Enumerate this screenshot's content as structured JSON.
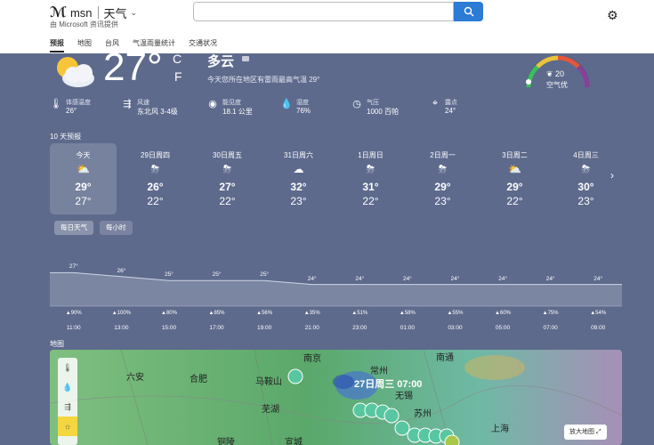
{
  "header": {
    "logo": "msn",
    "section": "天气",
    "provider": "由 Microsoft 资讯提供",
    "search_placeholder": "",
    "nav": [
      "预报",
      "地图",
      "台风",
      "气温雨量统计",
      "交通状况"
    ]
  },
  "current": {
    "temp": "27°",
    "unit_c": "C",
    "unit_f": "F",
    "condition": "多云",
    "description": "今天您所在地区有雷雨最高气温 29°",
    "aqi_value": "20",
    "aqi_label": "空气优",
    "details": [
      {
        "icon": "thermometer-icon",
        "label": "体感温度",
        "value": "26°"
      },
      {
        "icon": "wind-icon",
        "label": "风速",
        "value": "东北风 3-4级"
      },
      {
        "icon": "eye-icon",
        "label": "能见度",
        "value": "18.1 公里"
      },
      {
        "icon": "humidity-icon",
        "label": "湿度",
        "value": "76%"
      },
      {
        "icon": "pressure-icon",
        "label": "气压",
        "value": "1000 百帕"
      },
      {
        "icon": "dewpoint-icon",
        "label": "露点",
        "value": "24°"
      }
    ]
  },
  "forecast": {
    "title": "10 天预报",
    "days": [
      {
        "name": "今天",
        "icon": "partly-cloudy-icon",
        "hi": "29°",
        "lo": "27°"
      },
      {
        "name": "29日周四",
        "icon": "thunderstorm-icon",
        "hi": "26°",
        "lo": "22°"
      },
      {
        "name": "30日周五",
        "icon": "thunderstorm-icon",
        "hi": "27°",
        "lo": "22°"
      },
      {
        "name": "31日周六",
        "icon": "cloudy-icon",
        "hi": "32°",
        "lo": "23°"
      },
      {
        "name": "1日周日",
        "icon": "thunderstorm-icon",
        "hi": "31°",
        "lo": "22°"
      },
      {
        "name": "2日周一",
        "icon": "thunderstorm-icon",
        "hi": "29°",
        "lo": "23°"
      },
      {
        "name": "3日周二",
        "icon": "partly-cloudy-icon",
        "hi": "29°",
        "lo": "22°"
      },
      {
        "name": "4日周三",
        "icon": "thunderstorm-icon",
        "hi": "30°",
        "lo": "23°"
      }
    ],
    "tabs": [
      "每日天气",
      "每小时"
    ]
  },
  "hourly": {
    "temps": [
      27,
      26,
      25,
      25,
      25,
      24,
      24,
      24,
      24,
      24,
      24,
      24
    ],
    "temp_labels": [
      "27°",
      "26°",
      "25°",
      "25°",
      "25°",
      "24°",
      "24°",
      "24°",
      "24°",
      "24°",
      "24°",
      "24°"
    ],
    "precip": [
      "▲90%",
      "▲100%",
      "▲80%",
      "▲85%",
      "▲56%",
      "▲35%",
      "▲51%",
      "▲58%",
      "▲55%",
      "▲60%",
      "▲75%",
      "▲54%"
    ],
    "hours": [
      "11:00",
      "13:00",
      "15:00",
      "17:00",
      "19:00",
      "21:00",
      "23:00",
      "01:00",
      "03:00",
      "05:00",
      "07:00",
      "09:00"
    ]
  },
  "map": {
    "title": "地图",
    "time": "27日周三 07:00",
    "labels": [
      "六安",
      "合肥",
      "马鞍山",
      "南京",
      "常州",
      "南通",
      "无锡",
      "苏州",
      "芜湖",
      "上海",
      "铜陵",
      "宣城"
    ],
    "enlarge": "放大地图",
    "tools": [
      "thermometer-icon",
      "drop-icon",
      "wind-icon",
      "sun-icon"
    ]
  }
}
